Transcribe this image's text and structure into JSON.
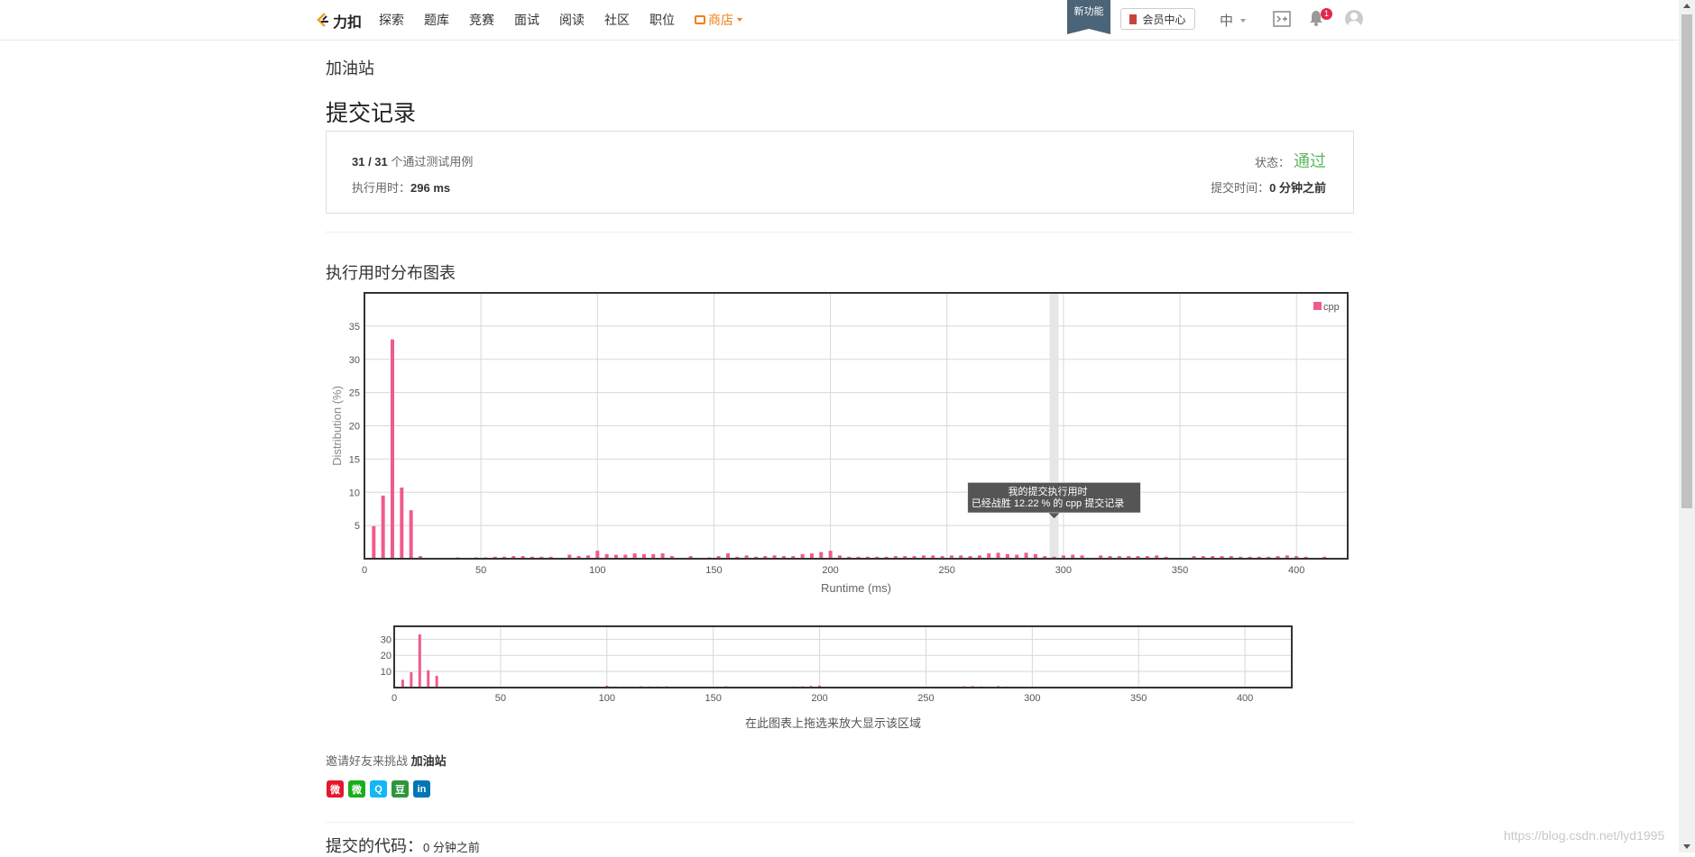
{
  "nav": {
    "logo_text": "力扣",
    "items": [
      "探索",
      "题库",
      "竞赛",
      "面试",
      "阅读",
      "社区",
      "职位"
    ],
    "store_label": "商店",
    "new_feature": "新功能",
    "member_center": "会员中心",
    "lang": "中",
    "notification_count": "1"
  },
  "problem": {
    "title": "加油站"
  },
  "page": {
    "title": "提交记录"
  },
  "result": {
    "tests_passed": "31 / 31",
    "tests_suffix": "个通过测试用例",
    "runtime_label": "执行用时：",
    "runtime_value": "296 ms",
    "status_label": "状态：",
    "status_value": "通过",
    "submit_time_label": "提交时间：",
    "submit_time_value": "0 分钟之前"
  },
  "chart_section": {
    "title": "执行用时分布图表"
  },
  "chart_data": [
    {
      "type": "bar",
      "xlabel": "Runtime (ms)",
      "ylabel": "Distribution (%)",
      "xlim": [
        0,
        422
      ],
      "ylim": [
        0,
        40
      ],
      "xticks": [
        0,
        50,
        100,
        150,
        200,
        250,
        300,
        350,
        400
      ],
      "yticks": [
        5,
        10,
        15,
        20,
        25,
        30,
        35
      ],
      "grid": true,
      "legend_position": "top-right",
      "series": [
        {
          "name": "cpp",
          "color": "#ef5b8b",
          "x": [
            4,
            8,
            12,
            16,
            20,
            24,
            40,
            48,
            52,
            56,
            60,
            64,
            68,
            72,
            76,
            80,
            88,
            92,
            96,
            100,
            104,
            108,
            112,
            116,
            120,
            124,
            128,
            132,
            140,
            148,
            152,
            156,
            160,
            164,
            168,
            172,
            176,
            180,
            184,
            188,
            192,
            196,
            200,
            204,
            208,
            212,
            216,
            220,
            224,
            228,
            232,
            236,
            240,
            244,
            248,
            252,
            256,
            260,
            264,
            268,
            272,
            276,
            280,
            284,
            288,
            292,
            296,
            300,
            304,
            308,
            316,
            320,
            324,
            328,
            332,
            336,
            340,
            344,
            356,
            360,
            364,
            368,
            372,
            376,
            380,
            384,
            388,
            392,
            396,
            400,
            404,
            412
          ],
          "values": [
            4.9,
            9.5,
            33,
            10.7,
            7.3,
            0.4,
            0.2,
            0.2,
            0.2,
            0.3,
            0.3,
            0.4,
            0.4,
            0.3,
            0.3,
            0.3,
            0.6,
            0.4,
            0.5,
            1.2,
            0.7,
            0.6,
            0.6,
            0.8,
            0.7,
            0.7,
            0.8,
            0.4,
            0.4,
            0.2,
            0.4,
            0.8,
            0.3,
            0.5,
            0.3,
            0.4,
            0.5,
            0.4,
            0.4,
            0.7,
            0.8,
            1.0,
            1.2,
            0.5,
            0.3,
            0.3,
            0.3,
            0.3,
            0.3,
            0.4,
            0.4,
            0.4,
            0.5,
            0.5,
            0.4,
            0.5,
            0.5,
            0.4,
            0.5,
            0.8,
            0.9,
            0.7,
            0.6,
            0.9,
            0.7,
            0.4,
            0.3,
            0.5,
            0.6,
            0.5,
            0.5,
            0.4,
            0.4,
            0.4,
            0.4,
            0.4,
            0.5,
            0.3,
            0.4,
            0.4,
            0.4,
            0.4,
            0.4,
            0.3,
            0.3,
            0.3,
            0.3,
            0.4,
            0.5,
            0.4,
            0.3,
            0.3
          ]
        }
      ],
      "highlight_x": 296,
      "tooltip": [
        "我的提交执行用时",
        "已经战胜 12.22 % 的 cpp 提交记录"
      ]
    },
    {
      "type": "bar",
      "role": "navigator",
      "xlim": [
        0,
        422
      ],
      "ylim": [
        0,
        38
      ],
      "xticks": [
        0,
        50,
        100,
        150,
        200,
        250,
        300,
        350,
        400
      ],
      "yticks": [
        10,
        20,
        30
      ],
      "hint": "在此图表上拖选来放大显示该区域"
    }
  ],
  "share": {
    "invite_prefix": "邀请好友来挑战",
    "invite_problem": "加油站",
    "icons": [
      {
        "name": "weibo-icon",
        "color": "#e6162d",
        "glyph": "微"
      },
      {
        "name": "wechat-icon",
        "color": "#1aad19",
        "glyph": "微"
      },
      {
        "name": "qq-icon",
        "color": "#12b7f5",
        "glyph": "Q"
      },
      {
        "name": "douban-icon",
        "color": "#2e963d",
        "glyph": "豆"
      },
      {
        "name": "linkedin-icon",
        "color": "#0077b5",
        "glyph": "in"
      }
    ]
  },
  "code_section": {
    "title": "提交的代码：",
    "time": "0 分钟之前"
  },
  "watermark": "https://blog.csdn.net/lyd1995"
}
